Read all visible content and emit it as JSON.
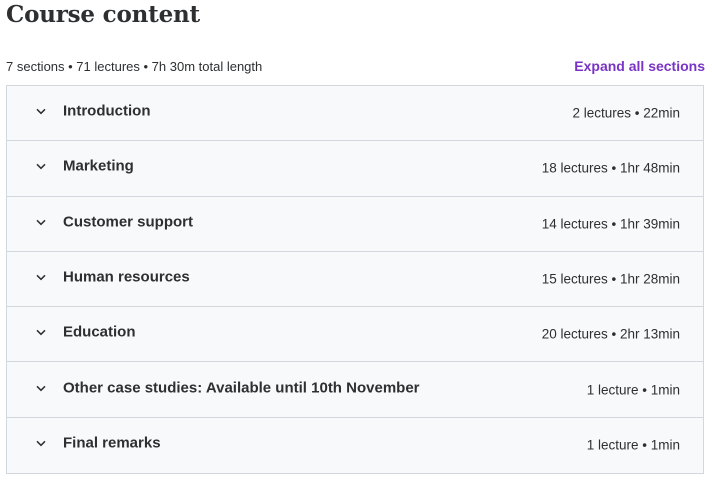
{
  "header": {
    "title": "Course content",
    "summary": "7 sections • 71 lectures • 7h 30m total length",
    "expand_label": "Expand all sections"
  },
  "accent_color": "#7a33c6",
  "sections": [
    {
      "title": "Introduction",
      "meta": "2 lectures • 22min"
    },
    {
      "title": "Marketing",
      "meta": "18 lectures • 1hr 48min"
    },
    {
      "title": "Customer support",
      "meta": "14 lectures • 1hr 39min"
    },
    {
      "title": "Human resources",
      "meta": "15 lectures • 1hr 28min"
    },
    {
      "title": "Education",
      "meta": "20 lectures • 2hr 13min"
    },
    {
      "title": "Other case studies: Available until 10th November",
      "meta": "1 lecture • 1min"
    },
    {
      "title": "Final remarks",
      "meta": "1 lecture • 1min"
    }
  ],
  "icons": {
    "section_toggle": "chevron-down-icon"
  }
}
